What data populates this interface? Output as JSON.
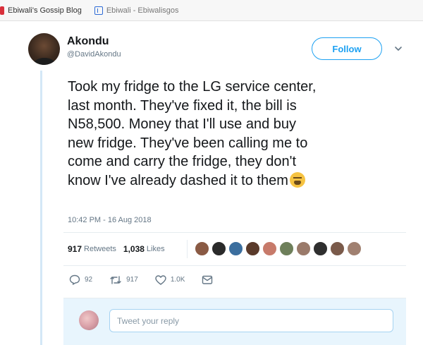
{
  "bookmarks": [
    {
      "label": "Ebiwali's Gossip Blog",
      "icon": "red-bookmark-icon"
    },
    {
      "label": "Ebiwali - Ebiwalisgos",
      "icon": "page-bookmark-icon"
    }
  ],
  "tweet": {
    "author_name": "Akondu",
    "author_handle": "@DavidAkondu",
    "follow_label": "Follow",
    "lines": [
      "Took my fridge to the LG service center,",
      "last month. They've fixed it, the bill is",
      "N58,500. Money that I'll use and buy",
      "new fridge. They've been calling me to",
      "come and carry the fridge, they don't",
      "know I've already dashed it to them"
    ],
    "emoji": "tired-face-emoji",
    "timestamp": "10:42 PM - 16 Aug 2018",
    "retweets_count": "917",
    "retweets_label": "Retweets",
    "likes_count": "1,038",
    "likes_label": "Likes",
    "liker_colors": [
      "#8a5a44",
      "#2a2a2a",
      "#3b6e9e",
      "#5a3a2a",
      "#c77a6a",
      "#6e7f5a",
      "#9a7a6a",
      "#2f2f2f",
      "#7a5a4a",
      "#a08070"
    ],
    "actions": {
      "reply_count": "92",
      "retweet_count": "917",
      "like_count": "1.0K"
    },
    "reply_placeholder": "Tweet your reply"
  },
  "colors": {
    "accent": "#1da1f2",
    "muted": "#657786",
    "text": "#14171a"
  }
}
